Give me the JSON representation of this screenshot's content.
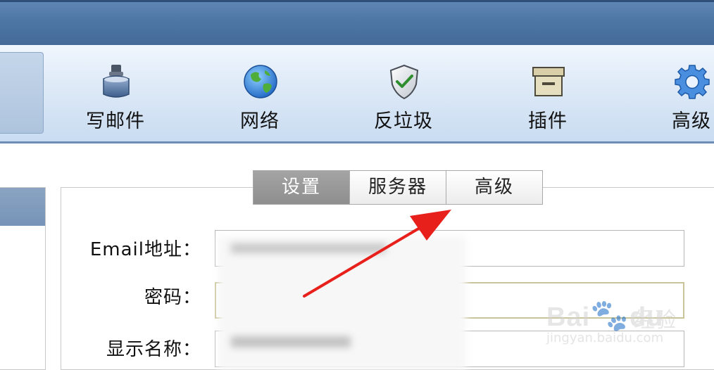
{
  "toolbar": {
    "items": [
      {
        "label": "写邮件",
        "icon": "write-mail-icon"
      },
      {
        "label": "网络",
        "icon": "globe-icon"
      },
      {
        "label": "反垃圾",
        "icon": "shield-check-icon"
      },
      {
        "label": "插件",
        "icon": "archive-box-icon"
      },
      {
        "label": "高级",
        "icon": "gear-icon"
      }
    ]
  },
  "tabs": [
    {
      "label": "设置",
      "active": true
    },
    {
      "label": "服务器",
      "active": false
    },
    {
      "label": "高级",
      "active": false
    }
  ],
  "form": {
    "email_label": "Email地址：",
    "password_label": "密码：",
    "display_name_label": "显示名称："
  },
  "watermark": {
    "brand": "Bai",
    "brand_suffix": "du",
    "cn": "经验",
    "url": "jingyan.baidu.com"
  },
  "colors": {
    "titlebar": "#4f77a6",
    "toolbar_bg": "#dde9f7",
    "active_tab": "#999999",
    "annotation_arrow": "#e8201c"
  }
}
